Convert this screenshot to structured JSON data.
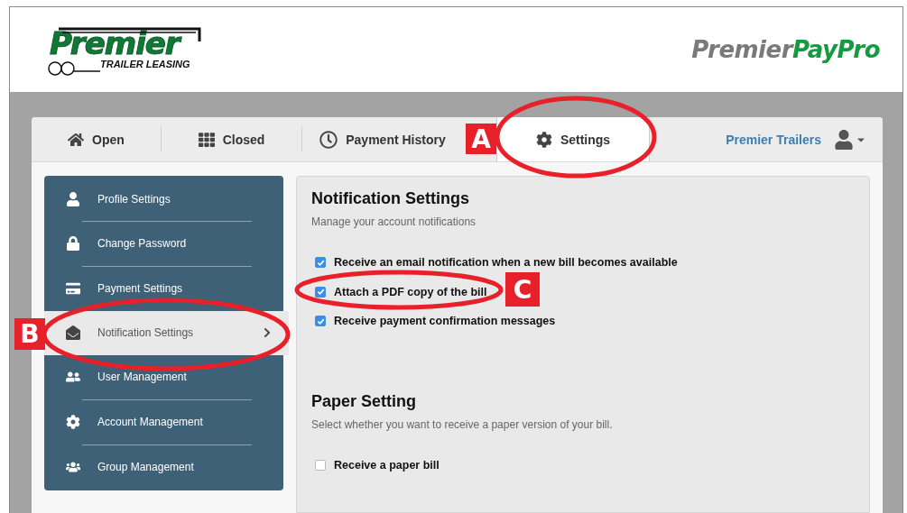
{
  "header": {
    "left_logo": {
      "name": "Premier",
      "tagline": "TRAILER LEASING"
    },
    "right_logo": {
      "part_1": "Premier",
      "part_2": "PayPro"
    }
  },
  "tabs": [
    {
      "label": "Open",
      "selected": false
    },
    {
      "label": "Closed",
      "selected": false
    },
    {
      "label": "Payment History",
      "selected": false
    },
    {
      "label": "Settings",
      "selected": true
    }
  ],
  "account": {
    "name": "Premier Trailers"
  },
  "sidebar": {
    "items": [
      {
        "label": "Profile Settings",
        "selected": false
      },
      {
        "label": "Change Password",
        "selected": false
      },
      {
        "label": "Payment Settings",
        "selected": false
      },
      {
        "label": "Notification Settings",
        "selected": true
      },
      {
        "label": "User Management",
        "selected": false
      },
      {
        "label": "Account Management",
        "selected": false
      },
      {
        "label": "Group Management",
        "selected": false
      }
    ]
  },
  "sections": [
    {
      "title": "Notification Settings",
      "subtitle": "Manage your account notifications",
      "options": [
        {
          "label": "Receive an email notification when a new bill becomes available",
          "checked": true
        },
        {
          "label": "Attach a PDF copy of the bill",
          "checked": true
        },
        {
          "label": "Receive payment confirmation messages",
          "checked": true
        }
      ]
    },
    {
      "title": "Paper Setting",
      "subtitle": "Select whether you want to receive a paper version of your bill.",
      "options": [
        {
          "label": "Receive a paper bill",
          "checked": false
        }
      ]
    }
  ],
  "annotations": [
    {
      "label": "A"
    },
    {
      "label": "B"
    },
    {
      "label": "C"
    }
  ]
}
